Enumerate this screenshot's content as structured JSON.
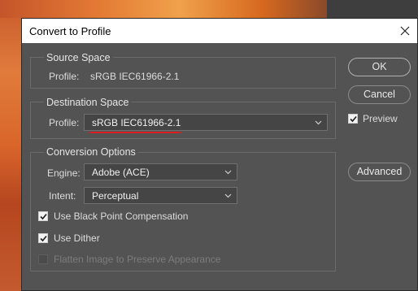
{
  "dialog": {
    "title": "Convert to Profile"
  },
  "source_space": {
    "title": "Source Space",
    "profile_label": "Profile:",
    "profile_value": "sRGB IEC61966-2.1"
  },
  "destination_space": {
    "title": "Destination Space",
    "profile_label": "Profile:",
    "profile_value": "sRGB IEC61966-2.1"
  },
  "conversion_options": {
    "title": "Conversion Options",
    "engine_label": "Engine:",
    "engine_value": "Adobe (ACE)",
    "intent_label": "Intent:",
    "intent_value": "Perceptual",
    "black_point_label": "Use Black Point Compensation",
    "black_point_checked": true,
    "dither_label": "Use Dither",
    "dither_checked": true,
    "flatten_label": "Flatten Image to Preserve Appearance",
    "flatten_checked": false,
    "flatten_enabled": false
  },
  "buttons": {
    "ok": "OK",
    "cancel": "Cancel",
    "advanced": "Advanced"
  },
  "preview": {
    "label": "Preview",
    "checked": true
  },
  "colors": {
    "dialog_bg": "#535353",
    "accent_underline": "#d81e1e"
  }
}
